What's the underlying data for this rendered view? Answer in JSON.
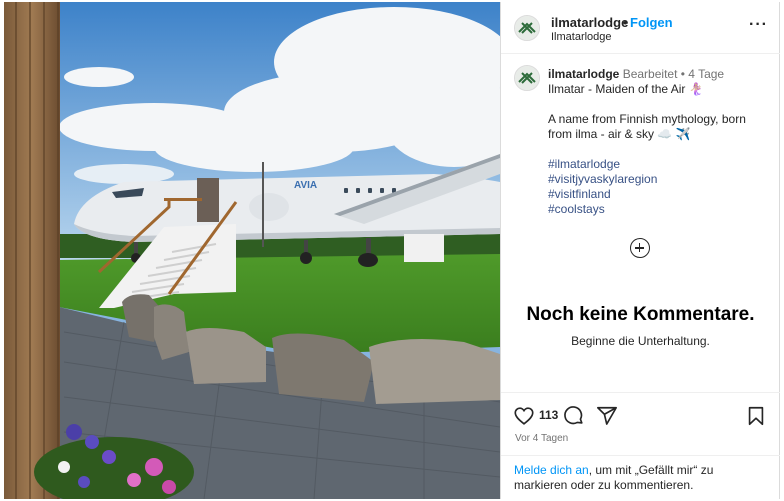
{
  "header": {
    "username": "ilmatarlodge",
    "dot": "•",
    "follow_label": "Folgen",
    "subtitle": "Ilmatarlodge",
    "more_label": "···"
  },
  "caption": {
    "username": "ilmatarlodge",
    "meta": "Bearbeitet • 4 Tage",
    "title_line": "Ilmatar - Maiden of the Air 🧜🏼‍♀️",
    "body_line": "A name from Finnish mythology, born from ilma - air & sky ☁️ ✈️",
    "hashtags": [
      "#ilmatarlodge",
      "#visitjyvaskylaregion",
      "#visitfinland",
      "#coolstays"
    ]
  },
  "comments": {
    "empty_title": "Noch keine Kommentare.",
    "empty_sub": "Beginne die Unterhaltung."
  },
  "actions": {
    "likes": "113",
    "posted_ago": "Vor 4 Tagen",
    "login_link": "Melde dich an",
    "login_text": ", um mit „Gefällt mir“ zu markieren oder zu kommentieren."
  },
  "photo": {
    "plane_livery": "AVIA",
    "icons": [
      "heart-icon",
      "comment-icon",
      "share-icon",
      "bookmark-icon",
      "add-comment-icon",
      "more-options-icon"
    ]
  }
}
